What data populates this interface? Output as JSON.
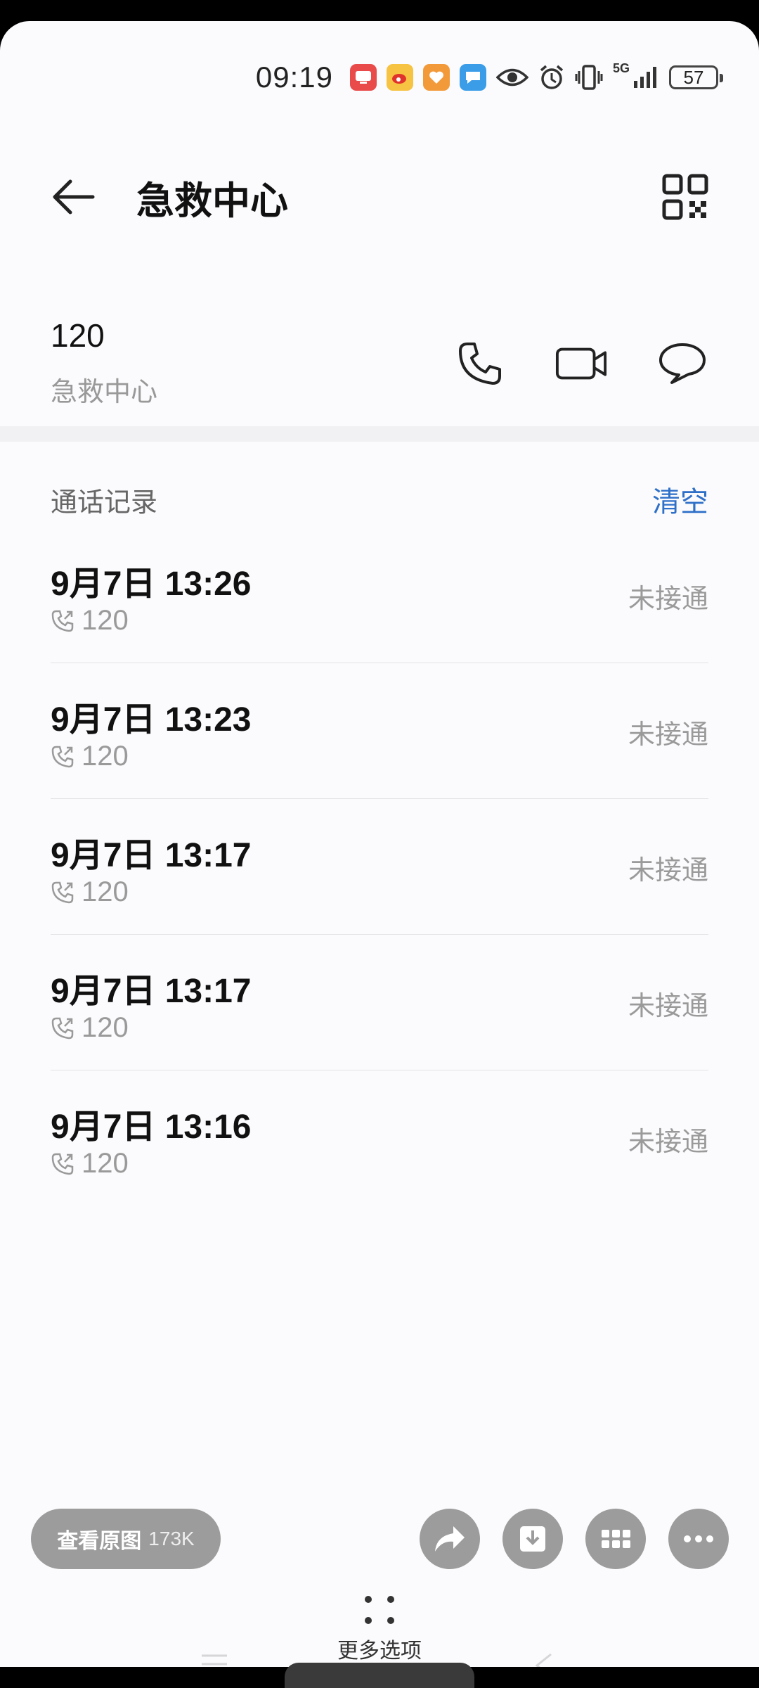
{
  "status_bar": {
    "time": "09:19",
    "battery": "57",
    "network": "5G",
    "icons": [
      "video-app-icon",
      "weibo-icon",
      "heart-app-icon",
      "message-app-icon",
      "eye-icon",
      "alarm-icon",
      "vibrate-icon",
      "signal-icon",
      "battery-icon"
    ]
  },
  "header": {
    "title": "急救中心",
    "back_icon": "back-arrow-icon",
    "qr_icon": "qr-code-icon"
  },
  "contact": {
    "number": "120",
    "name": "急救中心"
  },
  "call_log": {
    "title": "通话记录",
    "clear_label": "清空",
    "entries": [
      {
        "datetime": "9月7日 13:26",
        "number": "120",
        "status": "未接通"
      },
      {
        "datetime": "9月7日 13:23",
        "number": "120",
        "status": "未接通"
      },
      {
        "datetime": "9月7日 13:17",
        "number": "120",
        "status": "未接通"
      },
      {
        "datetime": "9月7日 13:17",
        "number": "120",
        "status": "未接通"
      },
      {
        "datetime": "9月7日 13:16",
        "number": "120",
        "status": "未接通"
      }
    ]
  },
  "viewer": {
    "view_original_label": "查看原图",
    "original_size": "173K",
    "more_options_label": "更多选项"
  },
  "colors": {
    "accent": "#2e6fc8",
    "muted": "#9a9a9a",
    "overlay_button": "#9c9c9c"
  }
}
